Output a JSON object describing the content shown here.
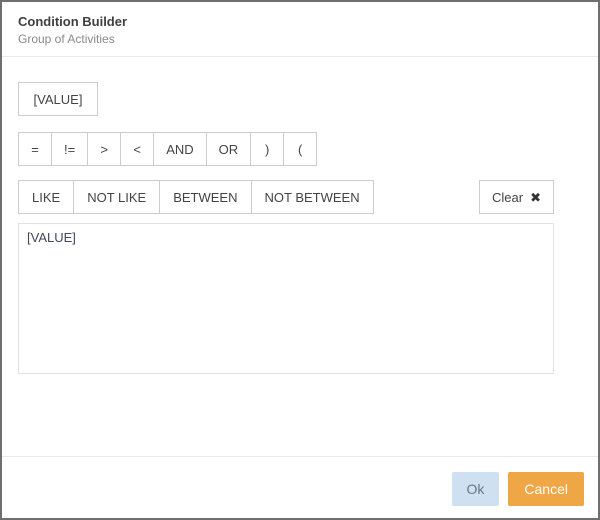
{
  "header": {
    "title": "Condition Builder",
    "subtitle": "Group of Activities"
  },
  "builder": {
    "value_button": "[VALUE]",
    "operators": [
      "=",
      "!=",
      ">",
      "<",
      "AND",
      "OR",
      ")",
      "("
    ],
    "keywords": [
      "LIKE",
      "NOT LIKE",
      "BETWEEN",
      "NOT BETWEEN"
    ],
    "clear": {
      "label": "Clear",
      "icon": "✖"
    },
    "expression": "[VALUE]"
  },
  "footer": {
    "ok": "Ok",
    "cancel": "Cancel"
  },
  "colors": {
    "dialog_border": "#6f6f6f",
    "button_border": "#cccccc",
    "divider": "#e9e9e9",
    "ok_bg": "#cfe0f2",
    "ok_text": "#6d7681",
    "cancel_bg": "#efa644",
    "cancel_text": "#ffffff",
    "expression_text": "#3e4a5c"
  }
}
